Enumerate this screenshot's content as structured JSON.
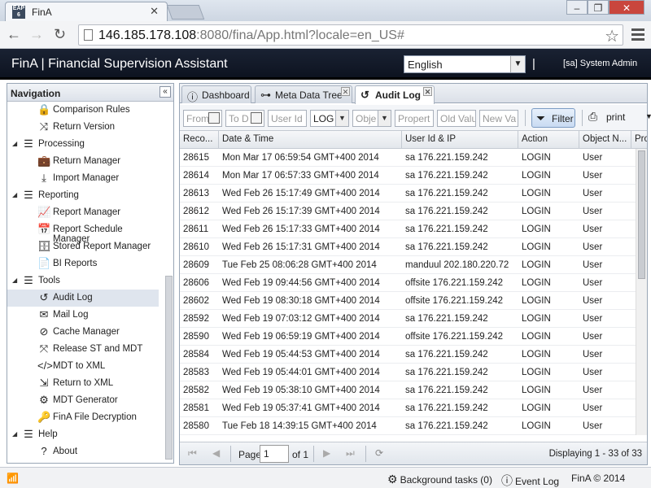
{
  "browser": {
    "tab_title": "FinA",
    "favicon_text": "EAP 6",
    "url_host": "146.185.178.108",
    "url_rest": ":8080/fina/App.html?locale=en_US#"
  },
  "header": {
    "app_title": "FinA | Financial Supervision Assistant",
    "language": "English",
    "separator": "|",
    "user": "[sa] System Admin"
  },
  "sidebar": {
    "title": "Navigation",
    "items": [
      {
        "type": "leaf",
        "label": "Comparison Rules",
        "icon": "lock-icon"
      },
      {
        "type": "leaf",
        "label": "Return Version",
        "icon": "shuffle-icon"
      },
      {
        "type": "group",
        "label": "Processing",
        "icon": "list-icon"
      },
      {
        "type": "leaf",
        "label": "Return Manager",
        "icon": "briefcase-icon"
      },
      {
        "type": "leaf",
        "label": "Import Manager",
        "icon": "import-icon"
      },
      {
        "type": "group",
        "label": "Reporting",
        "icon": "list-icon"
      },
      {
        "type": "leaf",
        "label": "Report Manager",
        "icon": "line-chart-icon"
      },
      {
        "type": "leaf",
        "label": "Report Schedule Manager",
        "icon": "calendar-icon"
      },
      {
        "type": "leaf",
        "label": "Stored Report Manager",
        "icon": "database-icon"
      },
      {
        "type": "leaf",
        "label": "BI Reports",
        "icon": "document-icon"
      },
      {
        "type": "group",
        "label": "Tools",
        "icon": "list-icon"
      },
      {
        "type": "leaf",
        "label": "Audit Log",
        "icon": "history-icon",
        "selected": true
      },
      {
        "type": "leaf",
        "label": "Mail Log",
        "icon": "mail-icon"
      },
      {
        "type": "leaf",
        "label": "Cache Manager",
        "icon": "no-entry-icon"
      },
      {
        "type": "leaf",
        "label": "Release ST and MDT",
        "icon": "compress-icon"
      },
      {
        "type": "leaf",
        "label": "MDT to XML",
        "icon": "code-icon"
      },
      {
        "type": "leaf",
        "label": "Return to XML",
        "icon": "file-export-icon"
      },
      {
        "type": "leaf",
        "label": "MDT Generator",
        "icon": "gears-icon"
      },
      {
        "type": "leaf",
        "label": "FinA File Decryption",
        "icon": "key-icon"
      },
      {
        "type": "group",
        "label": "Help",
        "icon": "list-icon"
      },
      {
        "type": "leaf",
        "label": "About",
        "icon": "question-icon"
      }
    ]
  },
  "tabs": [
    {
      "label": "Dashboard",
      "icon": "info-icon"
    },
    {
      "label": "Meta Data Tree",
      "icon": "tree-icon"
    },
    {
      "label": "Audit Log",
      "icon": "history-icon"
    }
  ],
  "filters": {
    "from": "From",
    "to": "To D",
    "user_id": "User Id",
    "action": "LOG",
    "object": "Obje",
    "property": "Propert",
    "old_value": "Old Valu",
    "new_value": "New Va",
    "filter_label": "Filter",
    "print_label": "print"
  },
  "grid": {
    "columns": [
      "Reco...",
      "Date & Time",
      "User Id & IP",
      "Action",
      "Object N...",
      "Pro"
    ],
    "rows": [
      [
        "28615",
        "Mon Mar 17 06:59:54 GMT+400 2014",
        "sa 176.221.159.242",
        "LOGIN",
        "User"
      ],
      [
        "28614",
        "Mon Mar 17 06:57:33 GMT+400 2014",
        "sa 176.221.159.242",
        "LOGIN",
        "User"
      ],
      [
        "28613",
        "Wed Feb 26 15:17:49 GMT+400 2014",
        "sa 176.221.159.242",
        "LOGIN",
        "User"
      ],
      [
        "28612",
        "Wed Feb 26 15:17:39 GMT+400 2014",
        "sa 176.221.159.242",
        "LOGIN",
        "User"
      ],
      [
        "28611",
        "Wed Feb 26 15:17:33 GMT+400 2014",
        "sa 176.221.159.242",
        "LOGIN",
        "User"
      ],
      [
        "28610",
        "Wed Feb 26 15:17:31 GMT+400 2014",
        "sa 176.221.159.242",
        "LOGIN",
        "User"
      ],
      [
        "28609",
        "Tue Feb 25 08:06:28 GMT+400 2014",
        "manduul 202.180.220.72",
        "LOGIN",
        "User"
      ],
      [
        "28606",
        "Wed Feb 19 09:44:56 GMT+400 2014",
        "offsite 176.221.159.242",
        "LOGIN",
        "User"
      ],
      [
        "28602",
        "Wed Feb 19 08:30:18 GMT+400 2014",
        "offsite 176.221.159.242",
        "LOGIN",
        "User"
      ],
      [
        "28592",
        "Wed Feb 19 07:03:12 GMT+400 2014",
        "sa 176.221.159.242",
        "LOGIN",
        "User"
      ],
      [
        "28590",
        "Wed Feb 19 06:59:19 GMT+400 2014",
        "offsite 176.221.159.242",
        "LOGIN",
        "User"
      ],
      [
        "28584",
        "Wed Feb 19 05:44:53 GMT+400 2014",
        "sa 176.221.159.242",
        "LOGIN",
        "User"
      ],
      [
        "28583",
        "Wed Feb 19 05:44:01 GMT+400 2014",
        "sa 176.221.159.242",
        "LOGIN",
        "User"
      ],
      [
        "28582",
        "Wed Feb 19 05:38:10 GMT+400 2014",
        "sa 176.221.159.242",
        "LOGIN",
        "User"
      ],
      [
        "28581",
        "Wed Feb 19 05:37:41 GMT+400 2014",
        "sa 176.221.159.242",
        "LOGIN",
        "User"
      ],
      [
        "28580",
        "Tue Feb 18 14:39:15 GMT+400 2014",
        "sa 176.221.159.242",
        "LOGIN",
        "User"
      ]
    ]
  },
  "pager": {
    "page_label": "Page",
    "page_value": "1",
    "of_label": "of 1",
    "displaying": "Displaying 1 - 33 of 33"
  },
  "statusbar": {
    "background_tasks": "Background tasks (0)",
    "event_log": "Event Log",
    "copyright": "FinA © 2014"
  }
}
